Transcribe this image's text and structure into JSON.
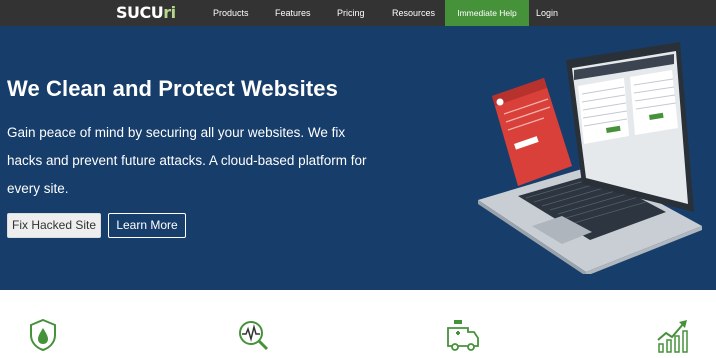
{
  "brand": {
    "logo_text_main": "SUCU",
    "logo_text_accent": "ri",
    "logo_icon": "sucuri-logo",
    "accent_color": "#46923a"
  },
  "nav": {
    "items": [
      {
        "label": "Products"
      },
      {
        "label": "Features"
      },
      {
        "label": "Pricing"
      },
      {
        "label": "Resources"
      },
      {
        "label": "Immediate Help"
      },
      {
        "label": "Login"
      }
    ]
  },
  "hero": {
    "title": "We Clean and Protect Websites",
    "subtitle_lines": [
      "Gain peace of mind by securing all your websites. We fix",
      "hacks and prevent future attacks. A cloud-based platform for",
      "every site."
    ],
    "buttons": {
      "fix_label": "Fix Hacked Site",
      "learn_label": "Learn More"
    },
    "background_color": "#173d6b",
    "illustration_icon": "laptop-dashboard-illustration"
  },
  "features": {
    "icons": [
      "shield-drop-icon",
      "magnifier-pulse-icon",
      "ambulance-icon",
      "growth-chart-icon"
    ],
    "icon_color": "#46923a"
  }
}
